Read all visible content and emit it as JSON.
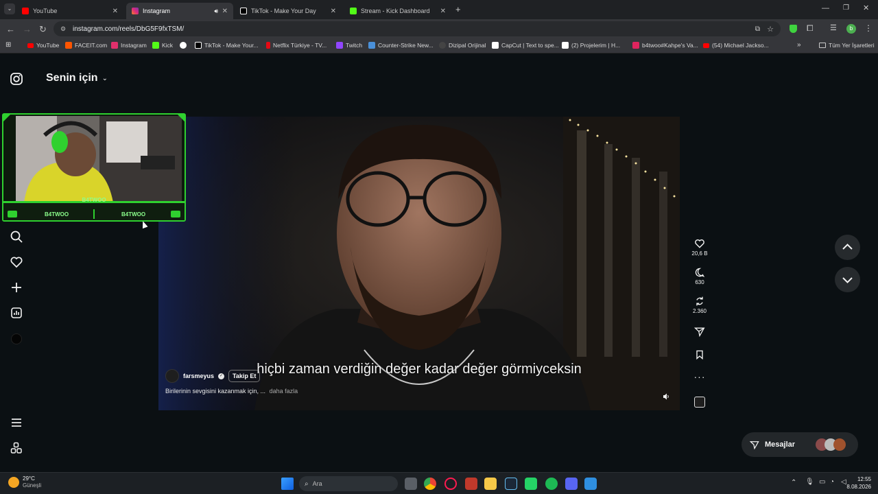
{
  "browser": {
    "tabs": [
      {
        "label": "YouTube",
        "active": false,
        "favicon_color": "#ff0000"
      },
      {
        "label": "Instagram",
        "active": true,
        "favicon_color": "#e1306c"
      },
      {
        "label": "TikTok - Make Your Day",
        "active": false,
        "favicon_color": "#ffffff"
      },
      {
        "label": "Stream - Kick Dashboard",
        "active": false,
        "favicon_color": "#53fc18"
      }
    ],
    "url": "instagram.com/reels/DbG5F9fxTSM/",
    "bookmarks": [
      {
        "label": "YouTube",
        "color": "#ff0000"
      },
      {
        "label": "FACEIT.com",
        "color": "#ff5500"
      },
      {
        "label": "Instagram",
        "color": "#e1306c"
      },
      {
        "label": "Kick",
        "color": "#53fc18"
      },
      {
        "label": "",
        "color": "#ffffff"
      },
      {
        "label": "TikTok - Make Your...",
        "color": "#ffffff"
      },
      {
        "label": "Netflix Türkiye - TV...",
        "color": "#e50914"
      },
      {
        "label": "Twitch",
        "color": "#9146ff"
      },
      {
        "label": "Counter-Strike New...",
        "color": "#4a90d9"
      },
      {
        "label": "Dizipal Orijinal",
        "color": "#444444"
      },
      {
        "label": "CapCut | Text to spe...",
        "color": "#ffffff"
      },
      {
        "label": "(2) Projelerim | H...",
        "color": "#ffffff"
      },
      {
        "label": "b4twoo#Kahpe's Va...",
        "color": "#e0245e"
      },
      {
        "label": "(54) Michael Jackso...",
        "color": "#ff0000"
      }
    ],
    "all_bookmarks": "Tüm Yer İşaretleri"
  },
  "header": {
    "title": "Senin için"
  },
  "webcam": {
    "name_top": "B4TWOO",
    "name_left": "B4TWOO",
    "name_right": "B4TWOO"
  },
  "reel": {
    "username": "farsmeyus",
    "follow_label": "Takip Et",
    "caption": "Birilerinin sevgisini kazanmak için, ...",
    "more_label": "daha fazla",
    "subtitle": "hiçbi zaman verdiğin değer kadar değer görmiyceksin",
    "likes": "20,6 B",
    "comments": "630",
    "reposts": "2.360"
  },
  "messages": {
    "label": "Mesajlar"
  },
  "taskbar": {
    "weather_temp": "29°C",
    "weather_desc": "Güneşli",
    "search_placeholder": "Ara",
    "time": "12:55",
    "date": "8.08.2026"
  },
  "colors": {
    "accent_green": "#3fd33f",
    "page_bg": "#0b1013"
  }
}
